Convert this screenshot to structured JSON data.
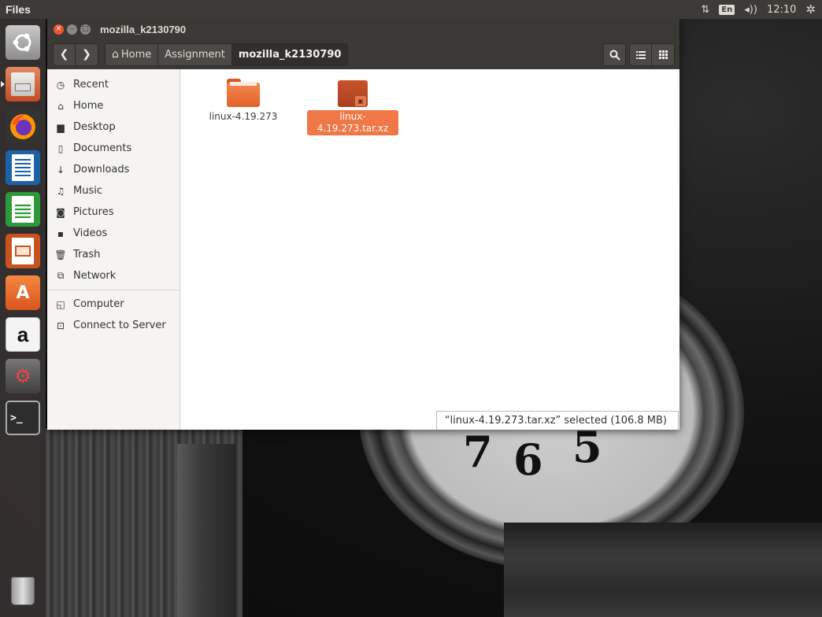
{
  "top_panel": {
    "app_name": "Files",
    "keyboard_layout": "En",
    "clock": "12:10"
  },
  "launcher": {
    "items": [
      {
        "name": "ubuntu-dash"
      },
      {
        "name": "files",
        "active": true
      },
      {
        "name": "firefox"
      },
      {
        "name": "libreoffice-writer"
      },
      {
        "name": "libreoffice-calc"
      },
      {
        "name": "libreoffice-impress"
      },
      {
        "name": "ubuntu-software"
      },
      {
        "name": "amazon"
      },
      {
        "name": "system-settings"
      },
      {
        "name": "terminal"
      },
      {
        "name": "trash"
      }
    ],
    "amazon_letter": "a",
    "terminal_prompt": ">_"
  },
  "window": {
    "title": "mozilla_k2130790",
    "breadcrumbs": [
      "Home",
      "Assignment",
      "mozilla_k2130790"
    ],
    "sidebar": {
      "places": [
        {
          "label": "Recent",
          "icon": "clock-icon"
        },
        {
          "label": "Home",
          "icon": "home-icon"
        },
        {
          "label": "Desktop",
          "icon": "folder-icon"
        },
        {
          "label": "Documents",
          "icon": "document-icon"
        },
        {
          "label": "Downloads",
          "icon": "download-icon"
        },
        {
          "label": "Music",
          "icon": "music-icon"
        },
        {
          "label": "Pictures",
          "icon": "camera-icon"
        },
        {
          "label": "Videos",
          "icon": "video-icon"
        },
        {
          "label": "Trash",
          "icon": "trash-icon"
        },
        {
          "label": "Network",
          "icon": "network-icon"
        }
      ],
      "devices": [
        {
          "label": "Computer",
          "icon": "computer-icon"
        },
        {
          "label": "Connect to Server",
          "icon": "server-icon"
        }
      ]
    },
    "files": [
      {
        "name": "linux-4.19.273",
        "type": "folder",
        "selected": false
      },
      {
        "name": "linux-4.19.273.tar.xz",
        "type": "archive",
        "selected": true
      }
    ],
    "status": "“linux-4.19.273.tar.xz” selected  (106.8 MB)"
  },
  "wallpaper": {
    "clock_numerals": [
      "7",
      "6",
      "5"
    ]
  }
}
